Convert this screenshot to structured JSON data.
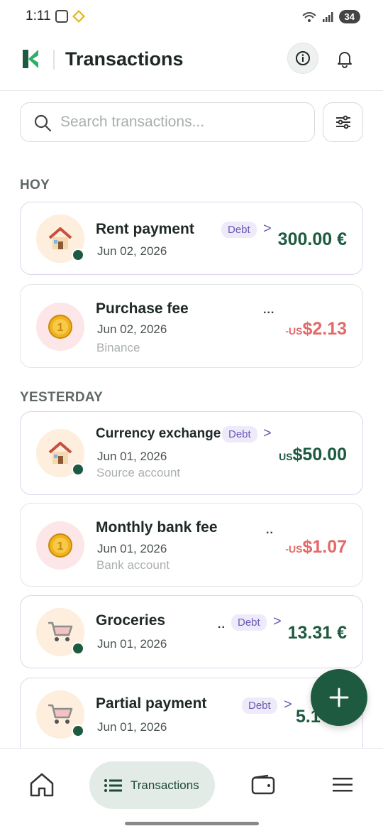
{
  "status_bar": {
    "time": "1:11",
    "battery": "34"
  },
  "header": {
    "title": "Transactions"
  },
  "search": {
    "placeholder": "Search transactions..."
  },
  "sections": [
    {
      "label": "HOY"
    },
    {
      "label": "YESTERDAY"
    }
  ],
  "transactions": [
    {
      "title": "Rent payment",
      "date": "Jun 02, 2026",
      "account": "",
      "badge": "Debt",
      "amount": "300.00 €",
      "icon": "house-icon"
    },
    {
      "title": "Purchase fee",
      "date": "Jun 02, 2026",
      "account": "Binance",
      "badge": "",
      "amount_prefix": "-US",
      "amount": "$2.13",
      "icon": "coin-icon"
    },
    {
      "title": "Currency exchange",
      "date": "Jun 01, 2026",
      "account": "Source account",
      "badge": "Debt",
      "amount_prefix": "US",
      "amount": "$50.00",
      "icon": "house-icon"
    },
    {
      "title": "Monthly bank fee",
      "date": "Jun 01, 2026",
      "account": "Bank account",
      "badge": "",
      "amount_prefix": "-US",
      "amount": "$1.07",
      "icon": "coin-icon"
    },
    {
      "title": "Groceries",
      "date": "Jun 01, 2026",
      "account": "",
      "badge": "Debt",
      "amount": "13.31 €",
      "icon": "cart-icon"
    },
    {
      "title": "Partial payment",
      "date": "Jun 01, 2026",
      "account": "",
      "badge": "Debt",
      "amount": "5.1",
      "icon": "cart-icon"
    }
  ],
  "nav": {
    "transactions_label": "Transactions"
  },
  "colors": {
    "brand": "#1d5a3f",
    "negative": "#e46a6a",
    "badge": "#6a5bb5"
  }
}
